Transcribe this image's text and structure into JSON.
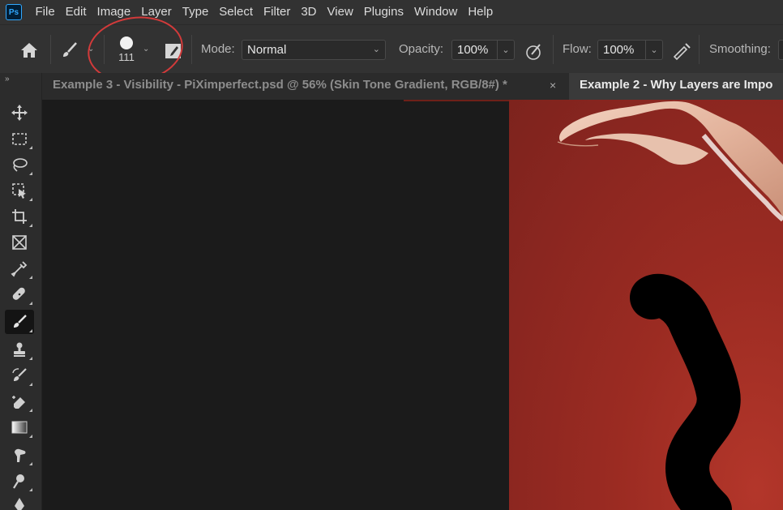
{
  "app": {
    "logo_text": "Ps"
  },
  "menu": [
    "File",
    "Edit",
    "Image",
    "Layer",
    "Type",
    "Select",
    "Filter",
    "3D",
    "View",
    "Plugins",
    "Window",
    "Help"
  ],
  "options": {
    "brush_size": "111",
    "mode_label": "Mode:",
    "mode_value": "Normal",
    "opacity_label": "Opacity:",
    "opacity_value": "100%",
    "flow_label": "Flow:",
    "flow_value": "100%",
    "smoothing_label": "Smoothing:"
  },
  "tabs": [
    {
      "label": "Example 3 - Visibility - PiXimperfect.psd @ 56% (Skin Tone Gradient, RGB/8#) *",
      "active": false
    },
    {
      "label": "Example 2 - Why Layers are Impo",
      "active": true
    }
  ],
  "toolbar": {
    "tools": [
      "move-tool",
      "marquee-tool",
      "lasso-tool",
      "object-selection-tool",
      "crop-tool",
      "frame-tool",
      "eyedropper-tool",
      "spot-healing-tool",
      "brush-tool",
      "clone-stamp-tool",
      "history-brush-tool",
      "eraser-tool",
      "gradient-tool",
      "smudge-tool",
      "dodge-tool",
      "pen-tool"
    ],
    "active": "brush-tool"
  },
  "colors": {
    "annotation_circle": "#d23a3a",
    "canvas_background": "#9b2b22"
  }
}
